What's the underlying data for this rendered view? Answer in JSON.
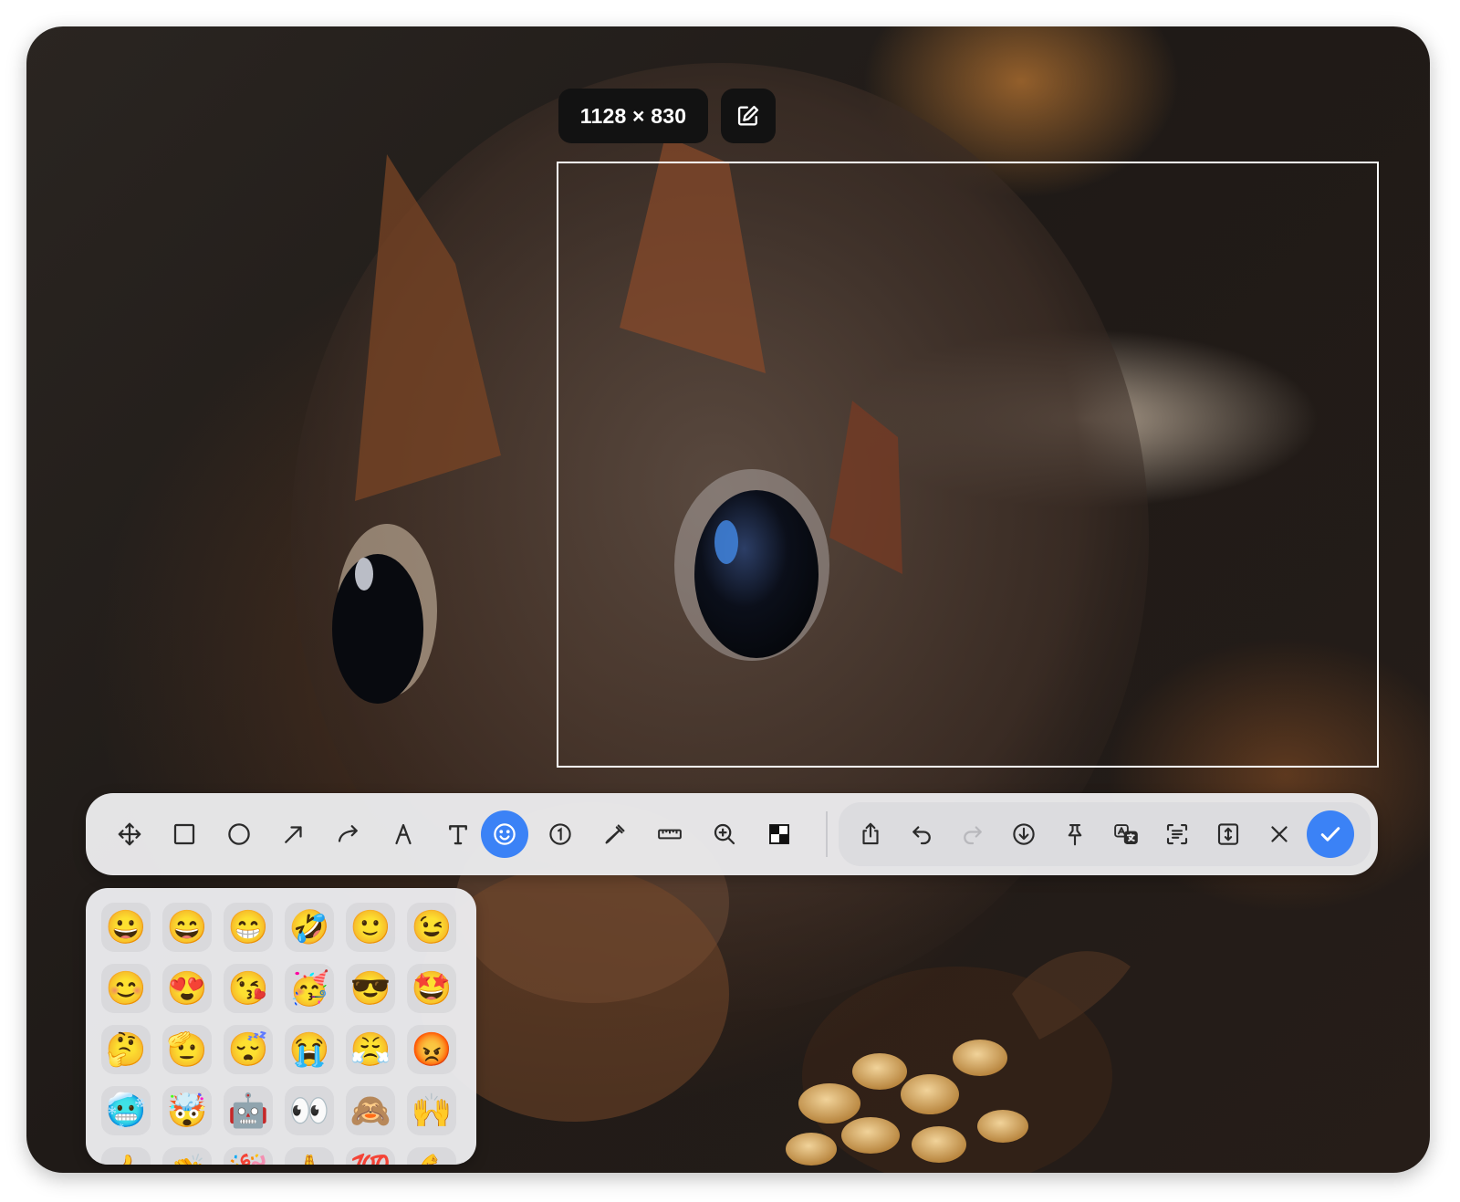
{
  "selection": {
    "size_label": "1128 × 830"
  },
  "colors": {
    "accent": "#3b82f6",
    "toolbar_bg": "#eaeaec",
    "pill_bg": "#121212",
    "icon": "#2b2b2b",
    "icon_disabled": "#b8b8bc"
  },
  "toolbar": {
    "tools": [
      {
        "name": "move-icon"
      },
      {
        "name": "rectangle-icon"
      },
      {
        "name": "ellipse-icon"
      },
      {
        "name": "arrow-icon"
      },
      {
        "name": "curved-arrow-icon"
      },
      {
        "name": "pen-icon"
      },
      {
        "name": "text-icon"
      },
      {
        "name": "emoji-icon",
        "active": true
      },
      {
        "name": "counter-icon",
        "label": "1"
      },
      {
        "name": "eyedropper-icon"
      },
      {
        "name": "ruler-icon"
      },
      {
        "name": "magnifier-icon"
      },
      {
        "name": "mosaic-icon"
      }
    ],
    "actions": [
      {
        "name": "share-icon"
      },
      {
        "name": "undo-icon"
      },
      {
        "name": "redo-icon",
        "disabled": true
      },
      {
        "name": "download-icon"
      },
      {
        "name": "pin-icon"
      },
      {
        "name": "translate-icon",
        "label": "A"
      },
      {
        "name": "ocr-icon"
      },
      {
        "name": "scroll-capture-icon"
      },
      {
        "name": "close-icon"
      },
      {
        "name": "checkmark-icon",
        "primary": true
      }
    ]
  },
  "emoji_panel": {
    "emojis": [
      [
        "😀",
        "😄",
        "😁",
        "🤣",
        "🙂",
        "😉"
      ],
      [
        "😊",
        "😍",
        "😘",
        "🥳",
        "😎",
        "🤩"
      ],
      [
        "🤔",
        "🫡",
        "😴",
        "😭",
        "😤",
        "😡"
      ],
      [
        "🥶",
        "🤯",
        "🤖",
        "👀",
        "🙈",
        "🙌"
      ],
      [
        "👍",
        "👏",
        "🎉",
        "🙏",
        "💯",
        "💪"
      ]
    ]
  }
}
